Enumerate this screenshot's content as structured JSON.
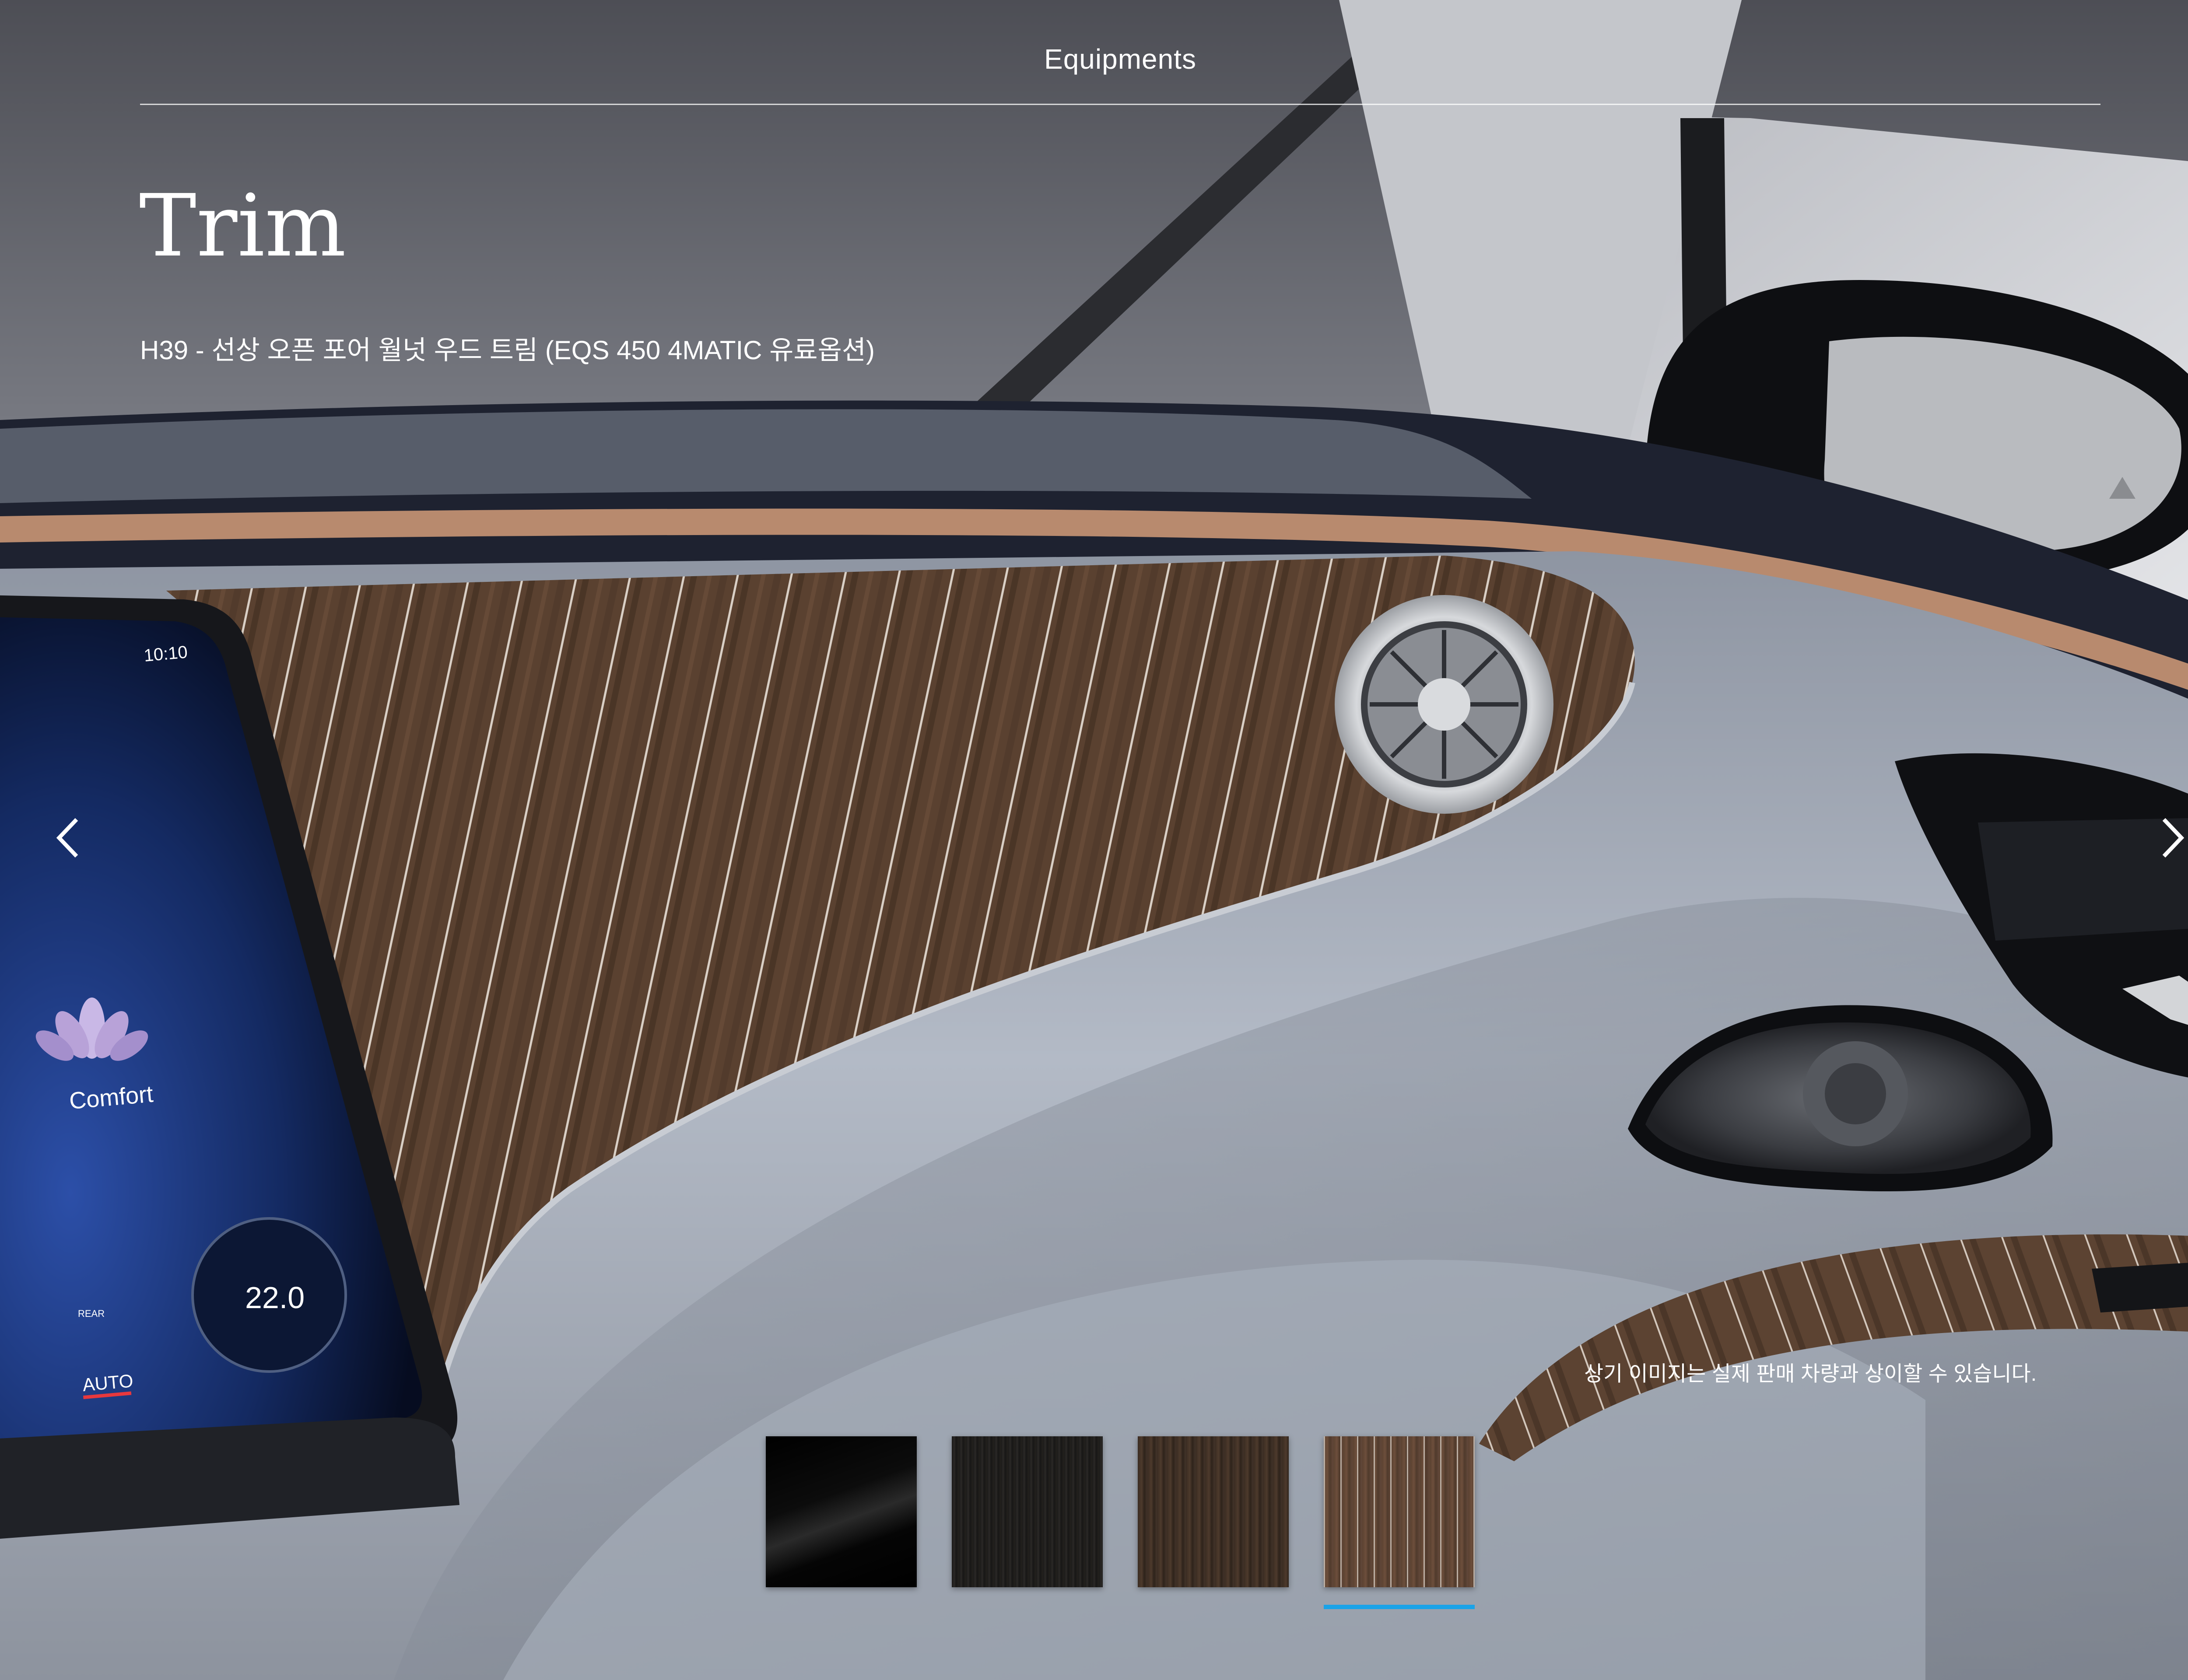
{
  "header": {
    "title": "Equipments"
  },
  "page": {
    "title": "Trim"
  },
  "trim": {
    "caption": "H39 - 선상 오픈 포어 월넛 우드 트림 (EQS 450 4MATIC 유료옵션)"
  },
  "disclaimer": "상기 이미지는 실제 판매 차량과 상이할 수 있습니다.",
  "navigation": {
    "prev_icon": "chevron-left-icon",
    "next_icon": "chevron-right-icon"
  },
  "swatches": [
    {
      "name": "black-gloss",
      "selected": false
    },
    {
      "name": "dark-wood",
      "selected": false
    },
    {
      "name": "walnut-wood",
      "selected": false
    },
    {
      "name": "yacht-open-pore-walnut",
      "selected": true
    }
  ],
  "screen": {
    "time": "10:10",
    "mode": "Comfort",
    "temperature": "22.0",
    "climate_mode": "AUTO",
    "rear_label": "REAR"
  },
  "colors": {
    "selected_indicator": "#1aa3e8",
    "text": "#ffffff"
  }
}
